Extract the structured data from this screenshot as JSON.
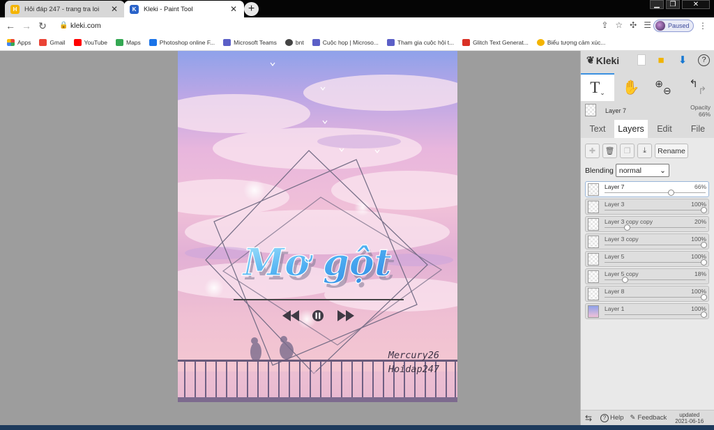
{
  "browser": {
    "tabs": [
      {
        "title": "Hỏi đáp 247 - trang tra loi",
        "favicon_color": "#f4b400"
      },
      {
        "title": "Kleki - Paint Tool",
        "favicon_color": "#2a63c9"
      }
    ],
    "new_tab": "+",
    "url": "kleki.com",
    "profile_status": "Paused",
    "bookmarks": [
      {
        "label": "Apps",
        "color": "#e8453c"
      },
      {
        "label": "Gmail",
        "color": "#ea4335"
      },
      {
        "label": "YouTube",
        "color": "#ff0000"
      },
      {
        "label": "Maps",
        "color": "#34a853"
      },
      {
        "label": "Photoshop online F...",
        "color": "#1a73e8"
      },
      {
        "label": "Microsoft Teams",
        "color": "#5b5fc7"
      },
      {
        "label": "bnt",
        "color": "#444444"
      },
      {
        "label": "Cuộc họp | Microso...",
        "color": "#5b5fc7"
      },
      {
        "label": "Tham gia cuộc hội t...",
        "color": "#5b5fc7"
      },
      {
        "label": "Glitch Text Generat...",
        "color": "#d93025"
      },
      {
        "label": "Biểu tượng cảm xúc...",
        "color": "#f4b400"
      }
    ]
  },
  "artwork": {
    "title_text": "Mơ gột",
    "signature_line1": "Mercury26",
    "signature_line2": "Hoidap247"
  },
  "kleki": {
    "logo": "Kleki",
    "current_layer": {
      "name": "Layer 7",
      "opacity_label": "Opacity",
      "opacity_value": "66%"
    },
    "tabs": [
      "Text",
      "Layers",
      "Edit",
      "File"
    ],
    "selected_tab": "Layers",
    "rename_label": "Rename",
    "blending_label": "Blending",
    "blending_value": "normal",
    "layers": [
      {
        "name": "Layer 7",
        "opacity": "66%",
        "value": 0.66,
        "selected": true
      },
      {
        "name": "Layer 3",
        "opacity": "100%",
        "value": 1.0
      },
      {
        "name": "Layer 3 copy copy",
        "opacity": "20%",
        "value": 0.2
      },
      {
        "name": "Layer 3 copy",
        "opacity": "100%",
        "value": 1.0
      },
      {
        "name": "Layer 5",
        "opacity": "100%",
        "value": 1.0
      },
      {
        "name": "Layer 5 copy",
        "opacity": "18%",
        "value": 0.18
      },
      {
        "name": "Layer 8",
        "opacity": "100%",
        "value": 1.0
      },
      {
        "name": "Layer 1",
        "opacity": "100%",
        "value": 1.0
      }
    ],
    "footer": {
      "help": "Help",
      "feedback": "Feedback",
      "updated_line1": "updated",
      "updated_line2": "2021-06-16"
    }
  }
}
